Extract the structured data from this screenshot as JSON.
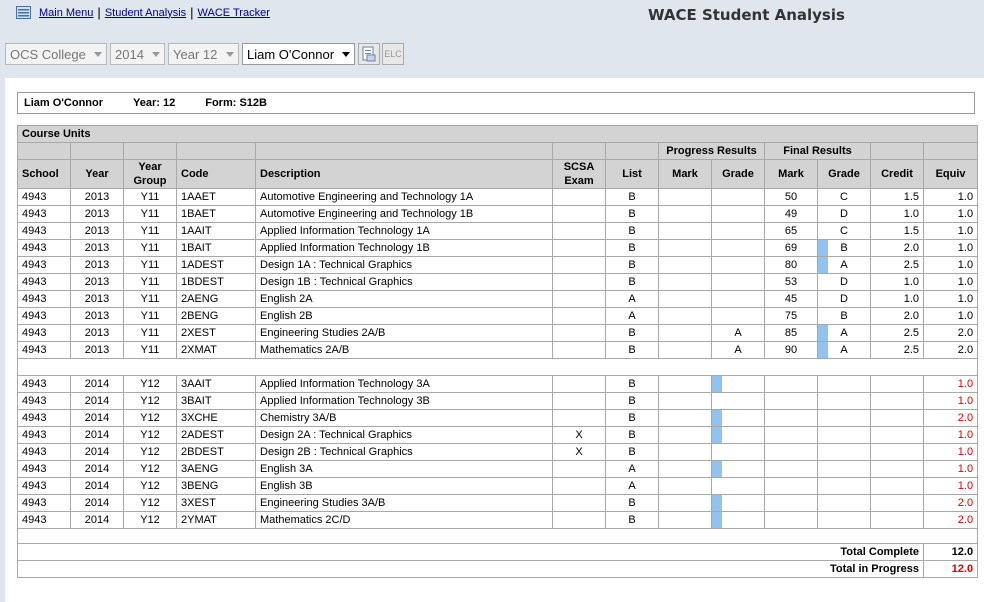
{
  "nav": {
    "main_menu": "Main Menu",
    "student_analysis": "Student Analysis",
    "wace_tracker": "WACE Tracker",
    "separator": "|"
  },
  "page_title": "WACE Student Analysis",
  "filters": {
    "school": "OCS College",
    "year": "2014",
    "year_level": "Year 12",
    "student": "Liam O'Connor",
    "elc_label": "ELC"
  },
  "student": {
    "name": "Liam O'Connor",
    "year_label": "Year: 12",
    "form_label": "Form: S12B"
  },
  "table": {
    "caption": "Course Units",
    "group_headers": {
      "progress": "Progress Results",
      "final": "Final Results"
    },
    "columns": {
      "school": "School",
      "year": "Year",
      "year_group": "Year Group",
      "code": "Code",
      "description": "Description",
      "scsa_exam": "SCSA Exam",
      "list": "List",
      "progress_mark": "Mark",
      "progress_grade": "Grade",
      "final_mark": "Mark",
      "final_grade": "Grade",
      "credit": "Credit",
      "equiv": "Equiv"
    },
    "completed_rows": [
      {
        "school": "4943",
        "year": "2013",
        "group": "Y11",
        "code": "1AAET",
        "description": "Automotive Engineering and Technology 1A",
        "scsa": "",
        "list": "B",
        "p_mark": "",
        "p_grade": "",
        "f_mark": "50",
        "f_grade": "C",
        "grade_bar": false,
        "credit": "1.5",
        "equiv": "1.0"
      },
      {
        "school": "4943",
        "year": "2013",
        "group": "Y11",
        "code": "1BAET",
        "description": "Automotive Engineering and Technology 1B",
        "scsa": "",
        "list": "B",
        "p_mark": "",
        "p_grade": "",
        "f_mark": "49",
        "f_grade": "D",
        "grade_bar": false,
        "credit": "1.0",
        "equiv": "1.0"
      },
      {
        "school": "4943",
        "year": "2013",
        "group": "Y11",
        "code": "1AAIT",
        "description": "Applied Information Technology 1A",
        "scsa": "",
        "list": "B",
        "p_mark": "",
        "p_grade": "",
        "f_mark": "65",
        "f_grade": "C",
        "grade_bar": false,
        "credit": "1.5",
        "equiv": "1.0"
      },
      {
        "school": "4943",
        "year": "2013",
        "group": "Y11",
        "code": "1BAIT",
        "description": "Applied Information Technology 1B",
        "scsa": "",
        "list": "B",
        "p_mark": "",
        "p_grade": "",
        "f_mark": "69",
        "f_grade": "B",
        "grade_bar": true,
        "credit": "2.0",
        "equiv": "1.0"
      },
      {
        "school": "4943",
        "year": "2013",
        "group": "Y11",
        "code": "1ADEST",
        "description": "Design 1A : Technical Graphics",
        "scsa": "",
        "list": "B",
        "p_mark": "",
        "p_grade": "",
        "f_mark": "80",
        "f_grade": "A",
        "grade_bar": true,
        "credit": "2.5",
        "equiv": "1.0"
      },
      {
        "school": "4943",
        "year": "2013",
        "group": "Y11",
        "code": "1BDEST",
        "description": "Design 1B : Technical Graphics",
        "scsa": "",
        "list": "B",
        "p_mark": "",
        "p_grade": "",
        "f_mark": "53",
        "f_grade": "D",
        "grade_bar": false,
        "credit": "1.0",
        "equiv": "1.0"
      },
      {
        "school": "4943",
        "year": "2013",
        "group": "Y11",
        "code": "2AENG",
        "description": "English 2A",
        "scsa": "",
        "list": "A",
        "p_mark": "",
        "p_grade": "",
        "f_mark": "45",
        "f_grade": "D",
        "grade_bar": false,
        "credit": "1.0",
        "equiv": "1.0"
      },
      {
        "school": "4943",
        "year": "2013",
        "group": "Y11",
        "code": "2BENG",
        "description": "English 2B",
        "scsa": "",
        "list": "A",
        "p_mark": "",
        "p_grade": "",
        "f_mark": "75",
        "f_grade": "B",
        "grade_bar": false,
        "credit": "2.0",
        "equiv": "1.0"
      },
      {
        "school": "4943",
        "year": "2013",
        "group": "Y11",
        "code": "2XEST",
        "description": "Engineering Studies 2A/B",
        "scsa": "",
        "list": "B",
        "p_mark": "",
        "p_grade": "A",
        "f_mark": "85",
        "f_grade": "A",
        "grade_bar": true,
        "credit": "2.5",
        "equiv": "2.0"
      },
      {
        "school": "4943",
        "year": "2013",
        "group": "Y11",
        "code": "2XMAT",
        "description": "Mathematics 2A/B",
        "scsa": "",
        "list": "B",
        "p_mark": "",
        "p_grade": "A",
        "f_mark": "90",
        "f_grade": "A",
        "grade_bar": true,
        "credit": "2.5",
        "equiv": "2.0"
      }
    ],
    "progress_rows": [
      {
        "school": "4943",
        "year": "2014",
        "group": "Y12",
        "code": "3AAIT",
        "description": "Applied Information Technology 3A",
        "scsa": "",
        "list": "B",
        "grade_bar": true,
        "equiv": "1.0"
      },
      {
        "school": "4943",
        "year": "2014",
        "group": "Y12",
        "code": "3BAIT",
        "description": "Applied Information Technology 3B",
        "scsa": "",
        "list": "B",
        "grade_bar": false,
        "equiv": "1.0"
      },
      {
        "school": "4943",
        "year": "2014",
        "group": "Y12",
        "code": "3XCHE",
        "description": "Chemistry 3A/B",
        "scsa": "",
        "list": "B",
        "grade_bar": true,
        "equiv": "2.0"
      },
      {
        "school": "4943",
        "year": "2014",
        "group": "Y12",
        "code": "2ADEST",
        "description": "Design 2A : Technical Graphics",
        "scsa": "X",
        "list": "B",
        "grade_bar": true,
        "equiv": "1.0"
      },
      {
        "school": "4943",
        "year": "2014",
        "group": "Y12",
        "code": "2BDEST",
        "description": "Design 2B : Technical Graphics",
        "scsa": "X",
        "list": "B",
        "grade_bar": false,
        "equiv": "1.0"
      },
      {
        "school": "4943",
        "year": "2014",
        "group": "Y12",
        "code": "3AENG",
        "description": "English 3A",
        "scsa": "",
        "list": "A",
        "grade_bar": true,
        "equiv": "1.0"
      },
      {
        "school": "4943",
        "year": "2014",
        "group": "Y12",
        "code": "3BENG",
        "description": "English 3B",
        "scsa": "",
        "list": "A",
        "grade_bar": false,
        "equiv": "1.0"
      },
      {
        "school": "4943",
        "year": "2014",
        "group": "Y12",
        "code": "3XEST",
        "description": "Engineering Studies 3A/B",
        "scsa": "",
        "list": "B",
        "grade_bar": true,
        "equiv": "2.0"
      },
      {
        "school": "4943",
        "year": "2014",
        "group": "Y12",
        "code": "2YMAT",
        "description": "Mathematics 2C/D",
        "scsa": "",
        "list": "B",
        "grade_bar": true,
        "equiv": "2.0"
      }
    ],
    "totals": {
      "complete_label": "Total Complete",
      "complete_value": "12.0",
      "progress_label": "Total in Progress",
      "progress_value": "12.0"
    }
  },
  "colors": {
    "bar": "#93c2ee",
    "in_progress_equiv": "#e00000",
    "header_bg": "#d3d3d3"
  }
}
